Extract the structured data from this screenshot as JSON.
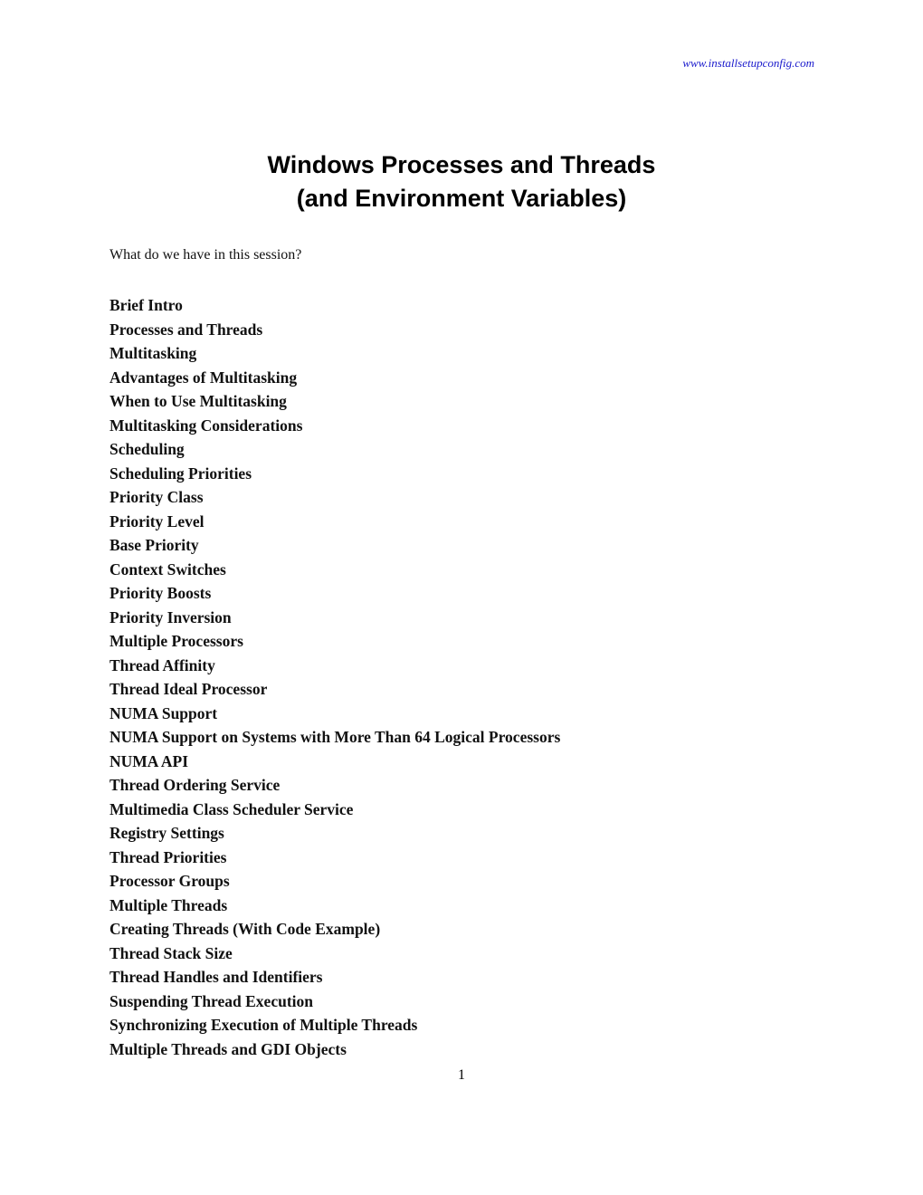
{
  "header": {
    "site_link": "www.installsetupconfig.com",
    "link_color": "#1a1acc"
  },
  "document": {
    "title_line1": "Windows Processes and Threads",
    "title_line2": "(and Environment Variables)",
    "intro": "What do we have in this session?",
    "toc": [
      "Brief Intro",
      "Processes and Threads",
      "Multitasking",
      "Advantages of Multitasking",
      "When to Use Multitasking",
      "Multitasking Considerations",
      "Scheduling",
      "Scheduling Priorities",
      "Priority Class",
      "Priority Level",
      "Base Priority",
      "Context Switches",
      "Priority Boosts",
      "Priority Inversion",
      "Multiple Processors",
      "Thread Affinity",
      "Thread Ideal Processor",
      "NUMA Support",
      "NUMA Support on Systems with More Than 64 Logical Processors",
      "NUMA API",
      "Thread Ordering Service",
      "Multimedia Class Scheduler Service",
      "Registry Settings",
      "Thread Priorities",
      "Processor Groups",
      "Multiple Threads",
      "Creating Threads (With Code Example)",
      "Thread Stack Size",
      "Thread Handles and Identifiers",
      "Suspending Thread Execution",
      "Synchronizing Execution of Multiple Threads",
      "Multiple Threads and GDI Objects"
    ]
  },
  "footer": {
    "page_number": "1"
  }
}
